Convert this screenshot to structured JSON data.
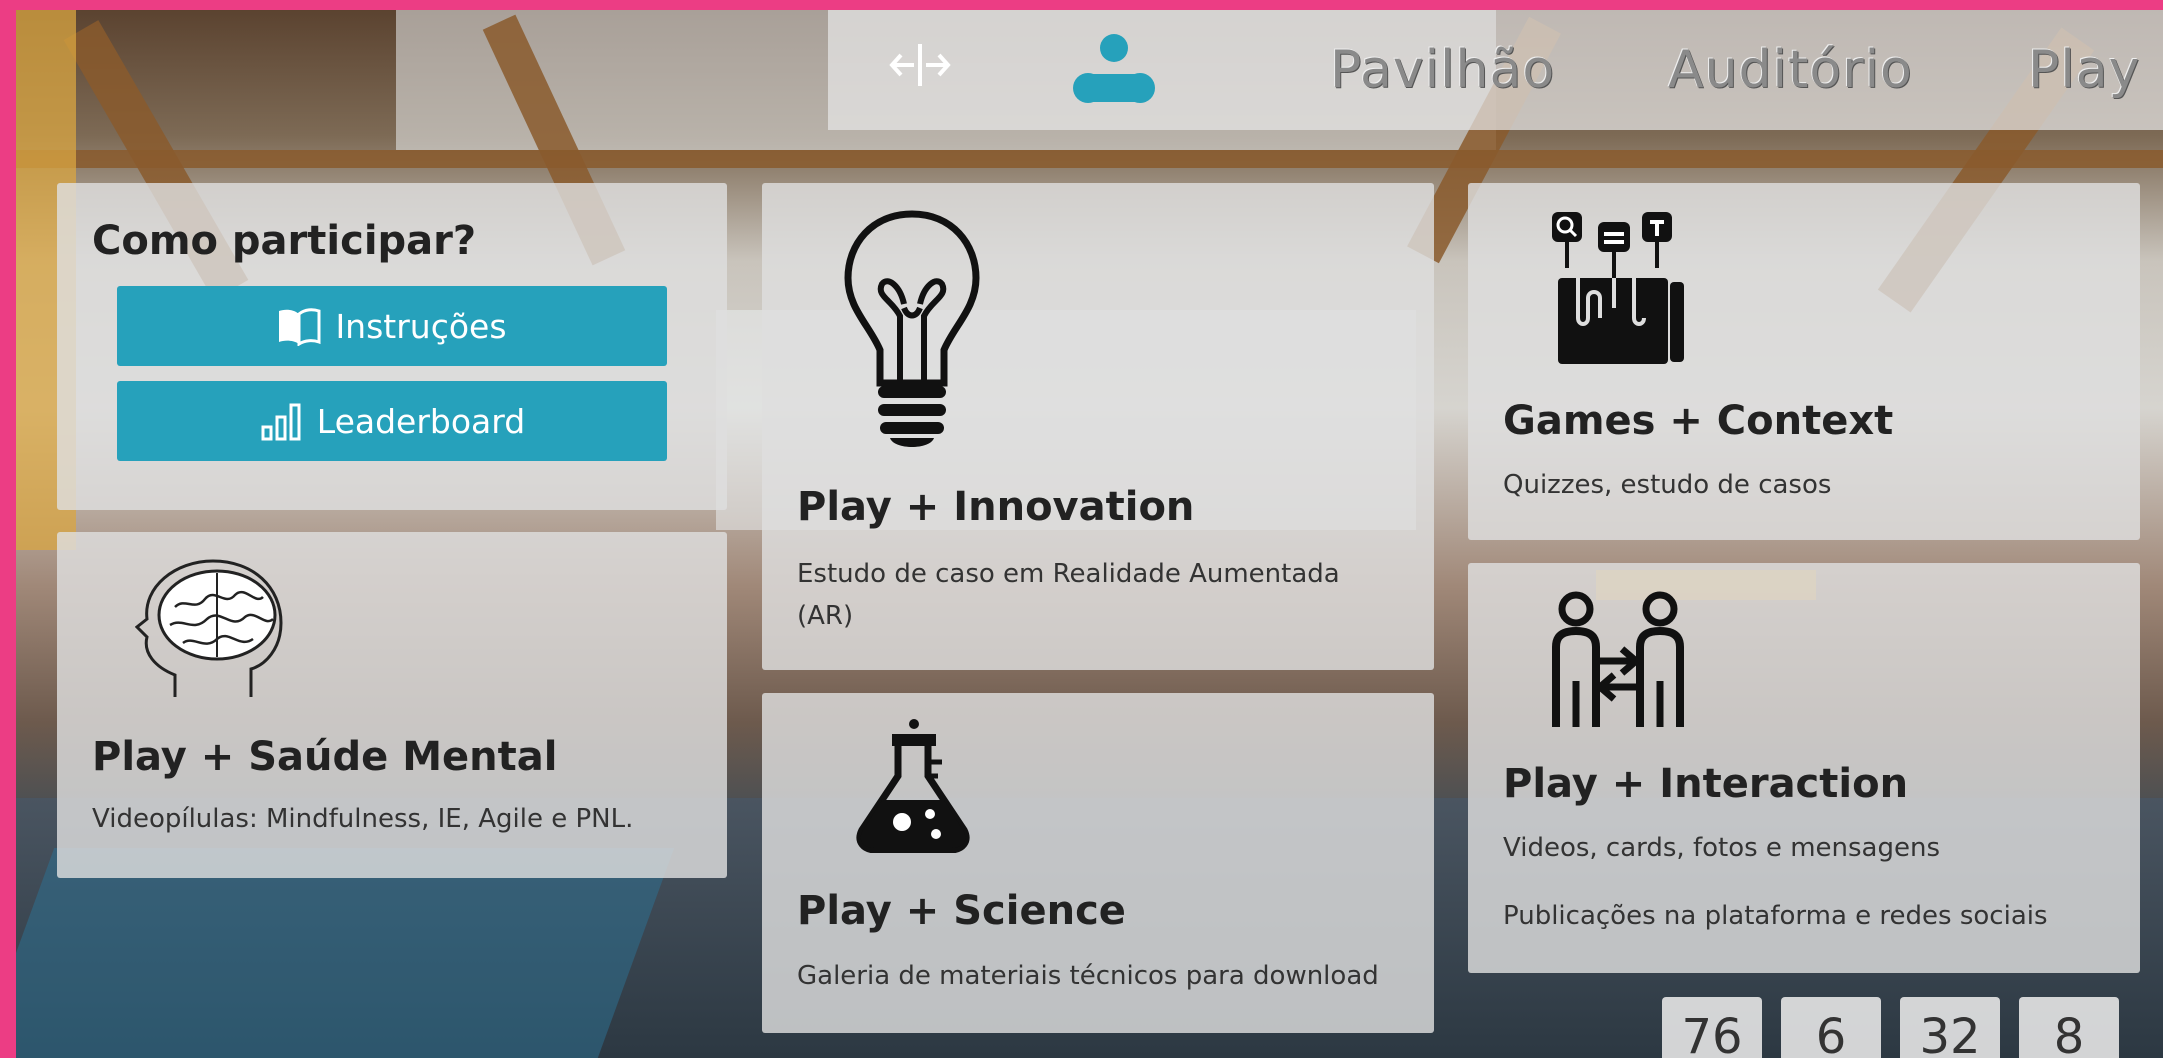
{
  "nav": {
    "items": [
      {
        "label": "Pavilhão"
      },
      {
        "label": "Auditório"
      },
      {
        "label": "Play"
      }
    ],
    "collapse_icon": "collapse-horizontal-icon",
    "logo_icon": "three-dots-logo-icon"
  },
  "participate": {
    "title": "Como participar?",
    "instructions_label": "Instruções",
    "instructions_icon": "book-icon",
    "leaderboard_label": "Leaderboard",
    "leaderboard_icon": "bar-chart-icon"
  },
  "cards": {
    "mental": {
      "title": "Play + Saúde Mental",
      "subtitle": "Videopílulas: Mindfulness, IE, Agile e PNL.",
      "icon": "brain-head-icon"
    },
    "innovation": {
      "title": "Play + Innovation",
      "subtitle": "Estudo de caso em Realidade Aumentada (AR)",
      "icon": "lightbulb-icon"
    },
    "science": {
      "title": "Play + Science",
      "subtitle": "Galeria de materiais técnicos para download",
      "icon": "flask-icon"
    },
    "games": {
      "title": "Games + Context",
      "subtitle": "Quizzes, estudo de casos",
      "icon": "touchscreen-apps-icon"
    },
    "interaction": {
      "title": "Play + Interaction",
      "subtitle": "Videos, cards, fotos e mensagens",
      "subtitle2": "Publicações na plataforma e redes sociais",
      "icon": "people-exchange-icon"
    }
  },
  "countdown": [
    "76",
    "6",
    "32",
    "8"
  ],
  "colors": {
    "accent": "#26a1bb",
    "frame_border": "#ec3d84",
    "card_bg": "#dedede"
  }
}
